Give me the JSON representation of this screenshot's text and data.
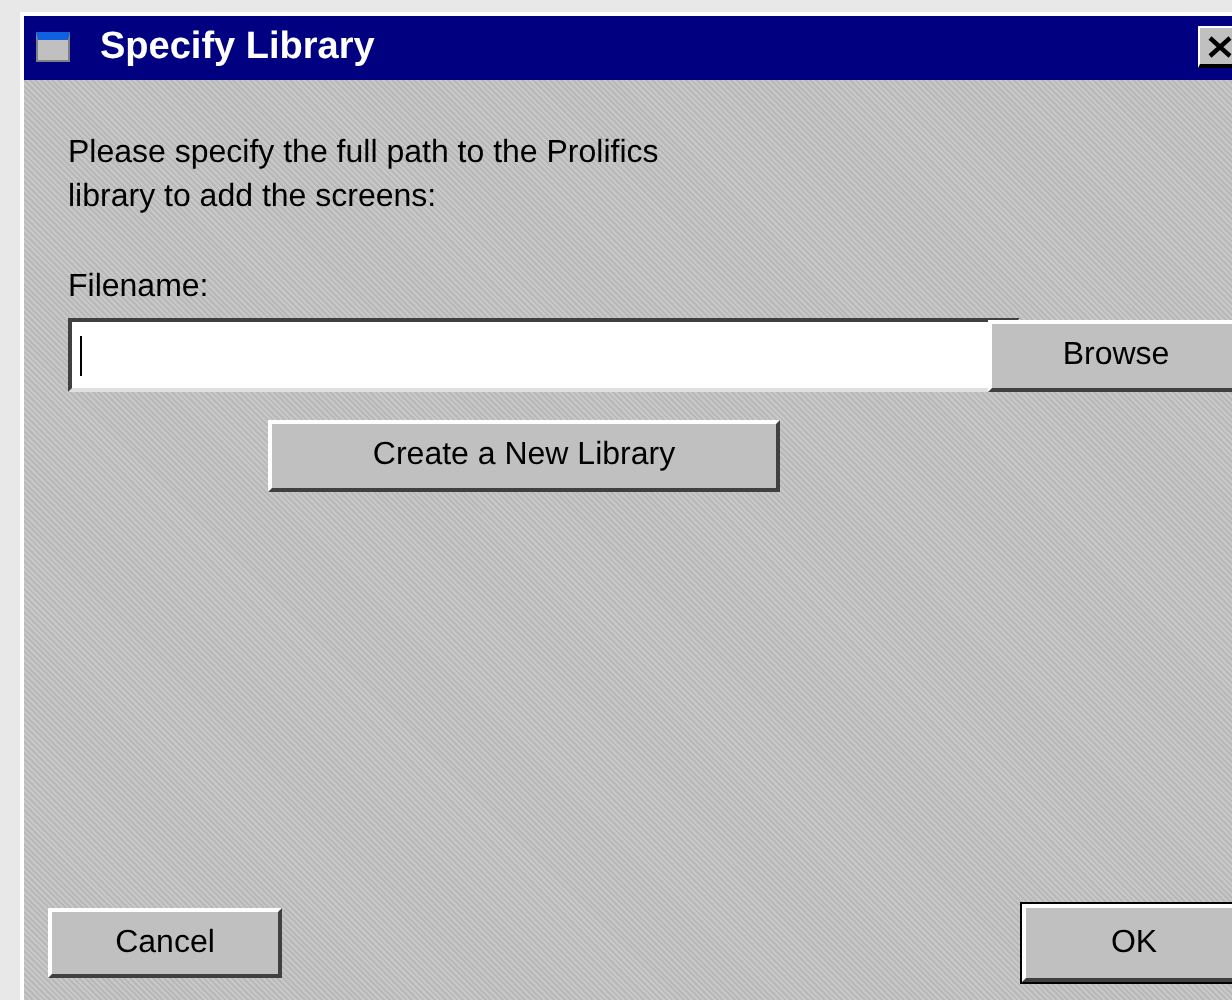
{
  "window": {
    "title": "Specify Library"
  },
  "instructions": [
    "Please specify the full path to the Prolifics",
    "library to add the screens:"
  ],
  "filename_field": {
    "label": "Filename:"
  },
  "buttons": {
    "browse": "Browse",
    "create": "Create a New Library",
    "cancel": "Cancel",
    "ok": "OK"
  }
}
